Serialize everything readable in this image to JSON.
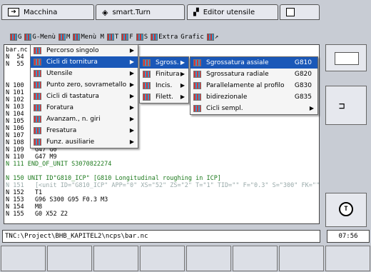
{
  "tabs": [
    {
      "label": "Macchina",
      "icon": "machine-arrow-icon"
    },
    {
      "label": "smart.Turn",
      "icon": "diamond-arrows-icon"
    },
    {
      "label": "Editor utensile",
      "icon": "tool-editor-icon"
    },
    {
      "label": "",
      "icon": "save-disk-icon"
    }
  ],
  "toolbar": [
    "G",
    "G-Menù",
    "M",
    "Menù M",
    "T",
    "F",
    "S",
    "Extra",
    "Grafic",
    "↗"
  ],
  "editor": {
    "lines": [
      {
        "text": "bar.nc",
        "color": "#000"
      },
      {
        "text": "N  54",
        "color": "#000"
      },
      {
        "text": "N  55",
        "color": "#000"
      },
      {
        "text": "",
        "color": "#000"
      },
      {
        "text": "",
        "color": "#000"
      },
      {
        "text": "N 100",
        "color": "#000"
      },
      {
        "text": "N 101",
        "color": "#000"
      },
      {
        "text": "N 102",
        "color": "#000"
      },
      {
        "text": "N 103",
        "color": "#000"
      },
      {
        "text": "N 104",
        "color": "#000"
      },
      {
        "text": "N 105",
        "color": "#000"
      },
      {
        "text": "N 106",
        "color": "#000"
      },
      {
        "text": "N 107",
        "color": "#000"
      },
      {
        "text": "N 108",
        "color": "#000"
      },
      {
        "text": "N 109   G47 G0",
        "color": "#000"
      },
      {
        "text": "N 110   G47 M9",
        "color": "#000"
      },
      {
        "text": "N 111 END_OF_UNIT S3070822274",
        "color": "#1d7a1d"
      },
      {
        "text": "",
        "color": "#000"
      },
      {
        "text": "N 150 UNIT ID\"G810_ICP\" [G810 Longitudinal roughing in ICP]",
        "color": "#1d7a1d"
      },
      {
        "text": "N 151   [<unit ID=\"G810_ICP\" APP=\"0\" XS=\"52\" ZS=\"2\" T=\"1\" TID=\"\" F=\"0.3\" S=\"300\" FK=\"\"",
        "color": "#9aa"
      },
      {
        "text": "N 152   T1",
        "color": "#000"
      },
      {
        "text": "N 153   G96 S300 G95 F0.3 M3",
        "color": "#000"
      },
      {
        "text": "N 154   M8",
        "color": "#000"
      },
      {
        "text": "N 155   G0 X52 Z2",
        "color": "#000"
      }
    ]
  },
  "menu1": [
    {
      "label": "Percorso singolo",
      "arrow": "▶",
      "selected": false
    },
    {
      "label": "Cicli di tornitura",
      "arrow": "▶",
      "selected": true
    },
    {
      "label": "Utensile",
      "arrow": "▶",
      "selected": false
    },
    {
      "label": "Punto zero, sovrametallo",
      "arrow": "▶",
      "selected": false
    },
    {
      "label": "Cicli di tastatura",
      "arrow": "▶",
      "selected": false
    },
    {
      "label": "Foratura",
      "arrow": "▶",
      "selected": false
    },
    {
      "label": "Avanzam., n. giri",
      "arrow": "▶",
      "selected": false
    },
    {
      "label": "Fresatura",
      "arrow": "▶",
      "selected": false
    },
    {
      "label": "Funz. ausiliarie",
      "arrow": "▶",
      "selected": false
    }
  ],
  "menu2": [
    {
      "label": "Sgross.",
      "arrow": "▶",
      "selected": true
    },
    {
      "label": "Finitura",
      "arrow": "▶",
      "selected": false
    },
    {
      "label": "Incis.",
      "arrow": "▶",
      "selected": false
    },
    {
      "label": "Filett.",
      "arrow": "▶",
      "selected": false
    }
  ],
  "menu3": [
    {
      "label": "Sgrossatura assiale",
      "code": "G810",
      "selected": true
    },
    {
      "label": "Sgrossatura radiale",
      "code": "G820",
      "selected": false
    },
    {
      "label": "Parallelamente al profilo",
      "code": "G830",
      "selected": false
    },
    {
      "label": "bidirezionale",
      "code": "G835",
      "selected": false
    },
    {
      "label": "Cicli sempl.",
      "code": "",
      "arrow": "▶",
      "selected": false
    }
  ],
  "status": {
    "path": "TNC:\\Project\\BHB_KAPITEL2\\ncps\\bar.nc",
    "time": "07:56"
  }
}
